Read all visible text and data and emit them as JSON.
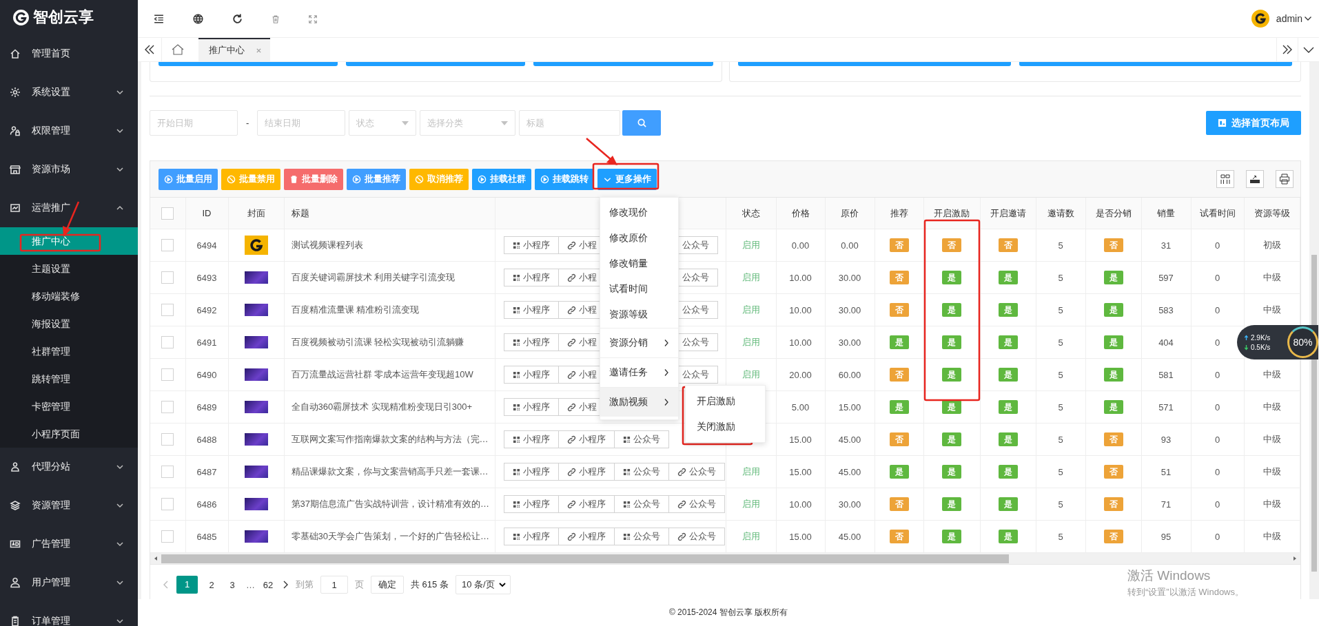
{
  "brand": {
    "name": "智创云享"
  },
  "sidebar": {
    "items": [
      {
        "label": "管理首页"
      },
      {
        "label": "系统设置",
        "expanded": false
      },
      {
        "label": "权限管理",
        "expanded": false
      },
      {
        "label": "资源市场",
        "expanded": false
      },
      {
        "label": "运营推广",
        "expanded": true,
        "children": [
          {
            "label": "推广中心",
            "selected": true
          },
          {
            "label": "主题设置",
            "selected": false
          },
          {
            "label": "移动端装修",
            "selected": false
          },
          {
            "label": "海报设置",
            "selected": false
          },
          {
            "label": "社群管理",
            "selected": false
          },
          {
            "label": "跳转管理",
            "selected": false
          },
          {
            "label": "卡密管理",
            "selected": false
          },
          {
            "label": "小程序页面",
            "selected": false
          }
        ]
      },
      {
        "label": "代理分站",
        "expanded": false
      },
      {
        "label": "资源管理",
        "expanded": false
      },
      {
        "label": "广告管理",
        "expanded": false
      },
      {
        "label": "用户管理",
        "expanded": false
      },
      {
        "label": "订单管理",
        "expanded": false
      }
    ]
  },
  "header": {
    "user": "admin"
  },
  "tabs": [
    {
      "label": "推广中心",
      "selected": true
    }
  ],
  "filters": {
    "start_date": {
      "placeholder": "开始日期"
    },
    "separator": "-",
    "end_date": {
      "placeholder": "结束日期"
    },
    "status": {
      "placeholder": "状态"
    },
    "category": {
      "placeholder": "选择分类"
    },
    "title": {
      "placeholder": "标题"
    }
  },
  "layout_button": "选择首页布局",
  "toolbar": [
    {
      "label": "批量启用",
      "kind": "primary"
    },
    {
      "label": "批量禁用",
      "kind": "warm"
    },
    {
      "label": "批量删除",
      "kind": "danger"
    },
    {
      "label": "批量推荐",
      "kind": "primary"
    },
    {
      "label": "取消推荐",
      "kind": "warm"
    },
    {
      "label": "挂载社群",
      "kind": "normal"
    },
    {
      "label": "挂载跳转",
      "kind": "normal"
    },
    {
      "label": "更多操作",
      "kind": "menu"
    }
  ],
  "more_menu": {
    "items": [
      {
        "label": "修改现价",
        "kind": "action",
        "selected": false
      },
      {
        "label": "修改原价",
        "kind": "action",
        "selected": false
      },
      {
        "label": "修改销量",
        "kind": "action",
        "selected": false
      },
      {
        "label": "试看时间",
        "kind": "action",
        "selected": false
      },
      {
        "label": "资源等级",
        "kind": "action",
        "selected": false
      },
      {
        "label": "资源分销",
        "kind": "submenu",
        "selected": false
      },
      {
        "label": "邀请任务",
        "kind": "submenu",
        "selected": false
      },
      {
        "label": "激励视频",
        "kind": "submenu",
        "selected": true,
        "children": [
          {
            "label": "开启激励"
          },
          {
            "label": "关闭激励"
          }
        ]
      }
    ]
  },
  "table": {
    "columns": [
      {
        "kind": "checkbox",
        "checked": false
      },
      {
        "kind": "text",
        "label": "ID"
      },
      {
        "kind": "text",
        "label": "封面"
      },
      {
        "kind": "title",
        "label": "标题"
      },
      {
        "kind": "links"
      },
      {
        "kind": "text",
        "label": "状态"
      },
      {
        "kind": "text",
        "label": "价格"
      },
      {
        "kind": "text",
        "label": "原价"
      },
      {
        "kind": "text",
        "label": "推荐"
      },
      {
        "kind": "text",
        "label": "开启激励"
      },
      {
        "kind": "text",
        "label": "开启邀请"
      },
      {
        "kind": "text",
        "label": "邀请数"
      },
      {
        "kind": "text",
        "label": "是否分销"
      },
      {
        "kind": "text",
        "label": "销量"
      },
      {
        "kind": "text",
        "label": "试看时间"
      },
      {
        "kind": "text",
        "label": "资源等级"
      }
    ],
    "rows": [
      {
        "checked": false,
        "id": "6494",
        "cover": {
          "kind": "logo"
        },
        "title": "测试视频课程列表",
        "links": [
          {
            "kind": "grid",
            "label": "小程序"
          },
          {
            "kind": "link",
            "label": "小程"
          },
          {
            "kind": "label",
            "label": "公众号"
          }
        ],
        "status": "启用",
        "price": "0.00",
        "original_price": "0.00",
        "recommend": {
          "text": "否",
          "on": false
        },
        "incentive": {
          "text": "否",
          "on": false
        },
        "invite": {
          "text": "否",
          "on": false
        },
        "invite_count": "5",
        "distribution": {
          "text": "否",
          "on": false
        },
        "sales": "31",
        "trial_time": "0",
        "grade": "初级"
      },
      {
        "checked": false,
        "id": "6493",
        "cover": {
          "kind": "image"
        },
        "title": "百度关键词霸屏技术 利用关键字引流变现",
        "links": [
          {
            "kind": "grid",
            "label": "小程序"
          },
          {
            "kind": "link",
            "label": "小程"
          },
          {
            "kind": "label",
            "label": "公众号"
          }
        ],
        "status": "启用",
        "price": "10.00",
        "original_price": "30.00",
        "recommend": {
          "text": "否",
          "on": false
        },
        "incentive": {
          "text": "是",
          "on": true
        },
        "invite": {
          "text": "是",
          "on": true
        },
        "invite_count": "5",
        "distribution": {
          "text": "是",
          "on": true
        },
        "sales": "597",
        "trial_time": "0",
        "grade": "中级"
      },
      {
        "checked": false,
        "id": "6492",
        "cover": {
          "kind": "image"
        },
        "title": "百度精准流量课 精准粉引流变现",
        "links": [
          {
            "kind": "grid",
            "label": "小程序"
          },
          {
            "kind": "link",
            "label": "小程"
          },
          {
            "kind": "label",
            "label": "公众号"
          }
        ],
        "status": "启用",
        "price": "10.00",
        "original_price": "30.00",
        "recommend": {
          "text": "否",
          "on": false
        },
        "incentive": {
          "text": "是",
          "on": true
        },
        "invite": {
          "text": "是",
          "on": true
        },
        "invite_count": "5",
        "distribution": {
          "text": "是",
          "on": true
        },
        "sales": "583",
        "trial_time": "0",
        "grade": "中级"
      },
      {
        "checked": false,
        "id": "6491",
        "cover": {
          "kind": "image"
        },
        "title": "百度视频被动引流课 轻松实现被动引流躺赚",
        "links": [
          {
            "kind": "grid",
            "label": "小程序"
          },
          {
            "kind": "link",
            "label": "小程"
          },
          {
            "kind": "label",
            "label": "公众号"
          }
        ],
        "status": "启用",
        "price": "10.00",
        "original_price": "30.00",
        "recommend": {
          "text": "是",
          "on": true
        },
        "incentive": {
          "text": "是",
          "on": true
        },
        "invite": {
          "text": "是",
          "on": true
        },
        "invite_count": "5",
        "distribution": {
          "text": "是",
          "on": true
        },
        "sales": "404",
        "trial_time": "0"
      },
      {
        "checked": false,
        "id": "6490",
        "cover": {
          "kind": "image"
        },
        "title": "百万流量战运营社群 零成本运营年变现超10W",
        "links": [
          {
            "kind": "grid",
            "label": "小程序"
          },
          {
            "kind": "link",
            "label": "小程"
          },
          {
            "kind": "label",
            "label": "公众号"
          }
        ],
        "status": "启用",
        "price": "20.00",
        "original_price": "60.00",
        "recommend": {
          "text": "否",
          "on": false
        },
        "incentive": {
          "text": "是",
          "on": true
        },
        "invite": {
          "text": "是",
          "on": true
        },
        "invite_count": "5",
        "distribution": {
          "text": "是",
          "on": true
        },
        "sales": "581",
        "trial_time": "0",
        "grade": "中级"
      },
      {
        "checked": false,
        "id": "6489",
        "cover": {
          "kind": "image"
        },
        "title": "全自动360霸屏技术 实现精准粉变现日引300+",
        "links": [
          {
            "kind": "grid",
            "label": "小程序"
          },
          {
            "kind": "link",
            "label": "小程"
          }
        ],
        "price": "5.00",
        "original_price": "15.00",
        "recommend": {
          "text": "是",
          "on": true
        },
        "incentive": {
          "text": "是",
          "on": true
        },
        "invite": {
          "text": "是",
          "on": true
        },
        "invite_count": "5",
        "distribution": {
          "text": "是",
          "on": true
        },
        "sales": "571",
        "trial_time": "0",
        "grade": "中级"
      },
      {
        "checked": false,
        "id": "6488",
        "cover": {
          "kind": "image"
        },
        "title": "互联网文案写作指南爆款文案的结构与方法（完…",
        "links": [
          {
            "kind": "grid",
            "label": "小程序"
          },
          {
            "kind": "link",
            "label": "小程序"
          },
          {
            "kind": "grid",
            "label": "公众号"
          }
        ],
        "price": "15.00",
        "original_price": "45.00",
        "recommend": {
          "text": "否",
          "on": false
        },
        "incentive": {
          "text": "是",
          "on": true
        },
        "invite": {
          "text": "是",
          "on": true
        },
        "invite_count": "5",
        "distribution": {
          "text": "否",
          "on": false
        },
        "sales": "93",
        "trial_time": "0",
        "grade": "中级"
      },
      {
        "checked": false,
        "id": "6487",
        "cover": {
          "kind": "image"
        },
        "title": "精品课爆款文案，你与文案营销高手只差一套课…",
        "links": [
          {
            "kind": "grid",
            "label": "小程序"
          },
          {
            "kind": "link",
            "label": "小程序"
          },
          {
            "kind": "grid",
            "label": "公众号"
          },
          {
            "kind": "link",
            "label": "公众号"
          }
        ],
        "status": "启用",
        "price": "15.00",
        "original_price": "45.00",
        "recommend": {
          "text": "是",
          "on": true
        },
        "incentive": {
          "text": "是",
          "on": true
        },
        "invite": {
          "text": "是",
          "on": true
        },
        "invite_count": "5",
        "distribution": {
          "text": "否",
          "on": false
        },
        "sales": "51",
        "trial_time": "0",
        "grade": "中级"
      },
      {
        "checked": false,
        "id": "6486",
        "cover": {
          "kind": "image"
        },
        "title": "第37期信息流广告实战特训营，设计精准有效的…",
        "links": [
          {
            "kind": "grid",
            "label": "小程序"
          },
          {
            "kind": "link",
            "label": "小程序"
          },
          {
            "kind": "grid",
            "label": "公众号"
          },
          {
            "kind": "link",
            "label": "公众号"
          }
        ],
        "status": "启用",
        "price": "10.00",
        "original_price": "30.00",
        "recommend": {
          "text": "否",
          "on": false
        },
        "incentive": {
          "text": "是",
          "on": true
        },
        "invite": {
          "text": "是",
          "on": true
        },
        "invite_count": "5",
        "distribution": {
          "text": "否",
          "on": false
        },
        "sales": "71",
        "trial_time": "0",
        "grade": "中级"
      },
      {
        "checked": false,
        "id": "6485",
        "cover": {
          "kind": "image"
        },
        "title": "零基础30天学会广告策划，一个好的广告轻松让…",
        "links": [
          {
            "kind": "grid",
            "label": "小程序"
          },
          {
            "kind": "link",
            "label": "小程序"
          },
          {
            "kind": "grid",
            "label": "公众号"
          },
          {
            "kind": "link",
            "label": "公众号"
          }
        ],
        "status": "启用",
        "price": "15.00",
        "original_price": "45.00",
        "recommend": {
          "text": "否",
          "on": false
        },
        "incentive": {
          "text": "是",
          "on": true
        },
        "invite": {
          "text": "是",
          "on": true
        },
        "invite_count": "5",
        "distribution": {
          "text": "否",
          "on": false
        },
        "sales": "95",
        "trial_time": "0",
        "grade": "中级"
      }
    ]
  },
  "pagination": {
    "pages": [
      {
        "label": "1",
        "kind": "page",
        "selected": true
      },
      {
        "label": "2",
        "kind": "page",
        "selected": false
      },
      {
        "label": "3",
        "kind": "page",
        "selected": false
      },
      {
        "label": "…",
        "kind": "ellipsis",
        "selected": false
      },
      {
        "label": "62",
        "kind": "page",
        "selected": false
      }
    ],
    "goto_label": "到第",
    "goto_value": "1",
    "page_unit": "页",
    "confirm": "确定",
    "total": "共 615 条",
    "page_size": "10 条/页"
  },
  "footer": "© 2015-2024 智创云享 版权所有",
  "net_monitor": {
    "upload": "2.9K/s",
    "download": "0.5K/s",
    "usage": "80%"
  },
  "system_notice": {
    "title": "激活 Windows",
    "text": "转到“设置”以激活 Windows。"
  }
}
